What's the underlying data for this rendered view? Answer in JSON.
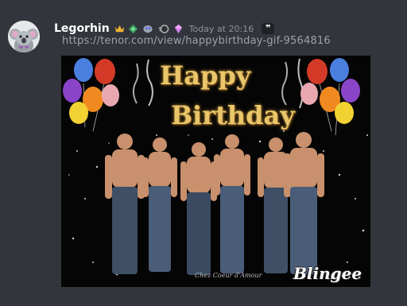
{
  "message": {
    "username": "Legorhin",
    "timestamp": "Today at 20:16",
    "link": "https://tenor.com/view/happybirthday-gif-9564816",
    "quote_icon": "quote-icon"
  },
  "badges": [
    "crown-icon",
    "diamond-icon",
    "bug-hunter-icon",
    "nitro-icon",
    "boost-gem-icon"
  ],
  "embed": {
    "title_line1": "Happy",
    "title_line2": "Birthday",
    "credit": "Chez Coeur d'Amour",
    "watermark": "Blingee"
  },
  "colors": {
    "background": "#36393f",
    "username": "#ffffff",
    "timestamp": "#8e9297",
    "link": "#9da2aa",
    "gold_text": "#e9c66a"
  }
}
